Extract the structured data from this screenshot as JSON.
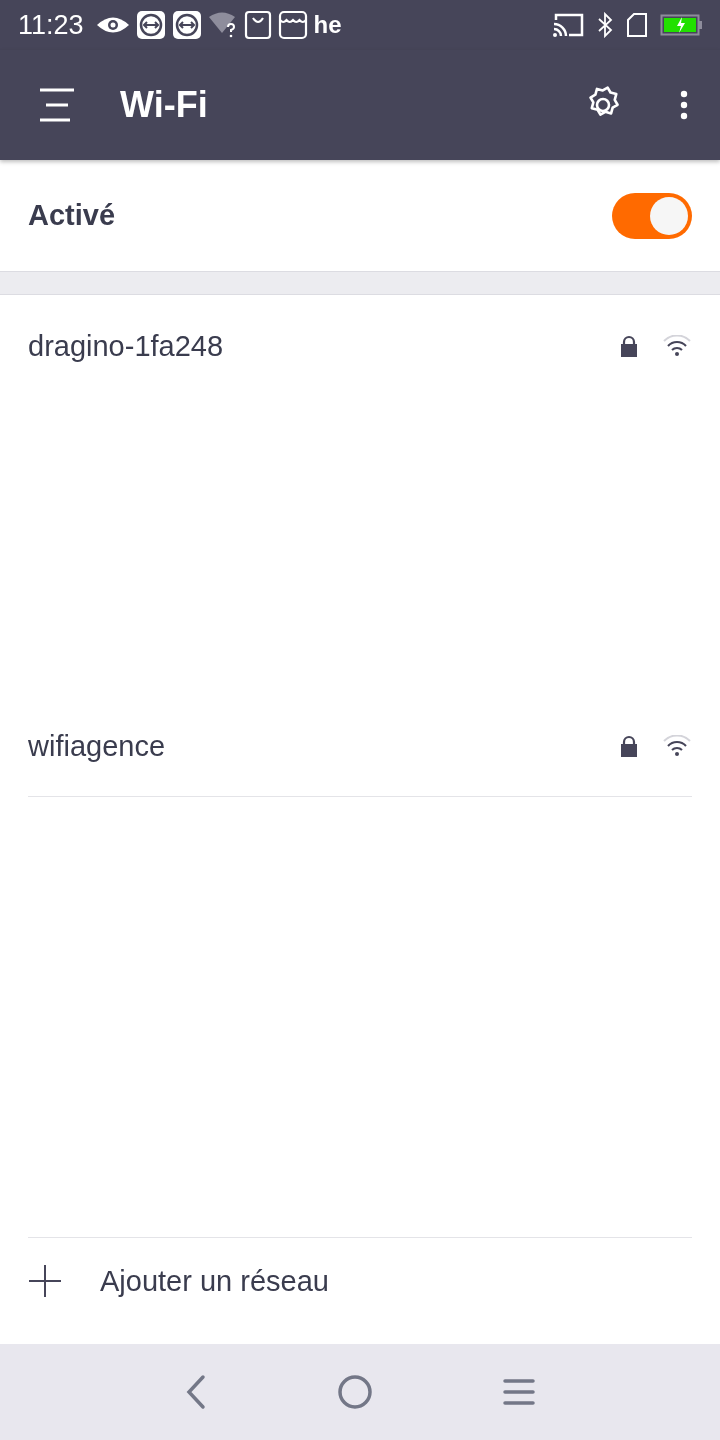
{
  "status_bar": {
    "time": "11:23",
    "app_logo_text": "he"
  },
  "app_bar": {
    "title": "Wi-Fi"
  },
  "wifi_toggle": {
    "label": "Activé",
    "on": true
  },
  "networks": [
    {
      "name": "dragino-1fa248",
      "secured": true
    },
    {
      "name": "wifiagence",
      "secured": true
    }
  ],
  "add_network": {
    "label": "Ajouter un réseau"
  }
}
